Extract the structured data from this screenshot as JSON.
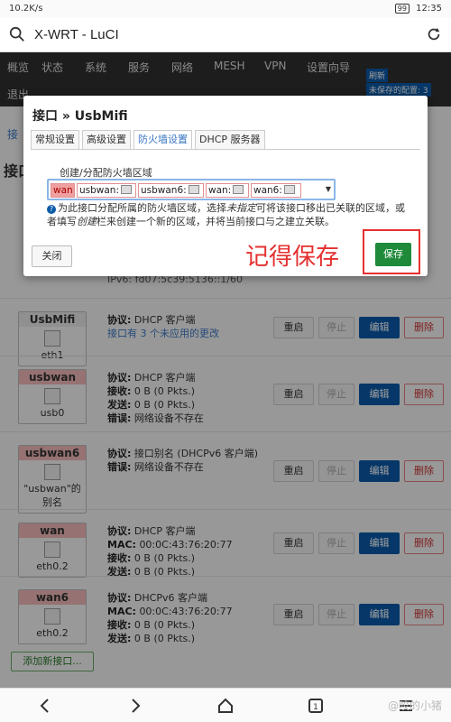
{
  "status": {
    "speed": "10.2K/s",
    "battery": "99",
    "time": "12:35"
  },
  "browser": {
    "title": "X-WRT - LuCI"
  },
  "nav": {
    "items": [
      "概览",
      "状态",
      "系统",
      "服务",
      "网络",
      "MESH",
      "VPN",
      "设置向导"
    ],
    "second_row": "退出",
    "badge_refresh": "刷新",
    "badge_unsaved": "未保存的配置: 3"
  },
  "page": {
    "breadcrumb": "接",
    "title": "接口",
    "ipv6_line": "IPv6: fd07:5c39:5136::1/60",
    "interfaces": [
      {
        "name": "UsbMifi",
        "sub": "eth1",
        "red": false,
        "lines": [
          {
            "k": "协议:",
            "v": "DHCP 客户端"
          }
        ],
        "link": "接口有 3 个未应用的更改"
      },
      {
        "name": "usbwan",
        "sub": "usb0",
        "red": true,
        "lines": [
          {
            "k": "协议:",
            "v": "DHCP 客户端"
          },
          {
            "k": "接收:",
            "v": "0 B (0 Pkts.)"
          },
          {
            "k": "发送:",
            "v": "0 B (0 Pkts.)"
          },
          {
            "k": "错误:",
            "v": "网络设备不存在"
          }
        ]
      },
      {
        "name": "usbwan6",
        "sub": "\"usbwan\"的别名",
        "red": true,
        "lines": [
          {
            "k": "协议:",
            "v": "接口别名 (DHCPv6 客户端)"
          },
          {
            "k": "错误:",
            "v": "网络设备不存在"
          }
        ]
      },
      {
        "name": "wan",
        "sub": "eth0.2",
        "red": true,
        "lines": [
          {
            "k": "协议:",
            "v": "DHCP 客户端"
          },
          {
            "k": "MAC:",
            "v": "00:0C:43:76:20:77"
          },
          {
            "k": "接收:",
            "v": "0 B (0 Pkts.)"
          },
          {
            "k": "发送:",
            "v": "0 B (0 Pkts.)"
          }
        ]
      },
      {
        "name": "wan6",
        "sub": "eth0.2",
        "red": true,
        "lines": [
          {
            "k": "协议:",
            "v": "DHCPv6 客户端"
          },
          {
            "k": "MAC:",
            "v": "00:0C:43:76:20:77"
          },
          {
            "k": "接收:",
            "v": "0 B (0 Pkts.)"
          },
          {
            "k": "发送:",
            "v": "0 B (0 Pkts.)"
          }
        ]
      }
    ],
    "buttons": {
      "restart": "重启",
      "stop": "停止",
      "edit": "编辑",
      "delete": "删除"
    },
    "add_button": "添加新接口..."
  },
  "modal": {
    "title": "接口 » UsbMifi",
    "tabs": [
      "常规设置",
      "高级设置",
      "防火墙设置",
      "DHCP 服务器"
    ],
    "active_tab": 2,
    "zone_label": "创建/分配防火墙区域",
    "zones": [
      "wan",
      "usbwan:",
      "usbwan6:",
      "wan:",
      "wan6:"
    ],
    "help_1": "为此接口分配所属的防火墙区域，选择",
    "help_em1": "未指定",
    "help_2": "可将该接口移出已关联的区域，或者填写",
    "help_em2": "创建",
    "help_3": "栏来创建一个新的区域，并将当前接口与之建立关联。",
    "close": "关闭",
    "save": "保存",
    "annotation": "记得保存"
  },
  "watermark": "@咬的小猪",
  "colors": {
    "accent": "#0a5aa8",
    "save": "#1f8a3a",
    "annotation": "#e53030"
  }
}
